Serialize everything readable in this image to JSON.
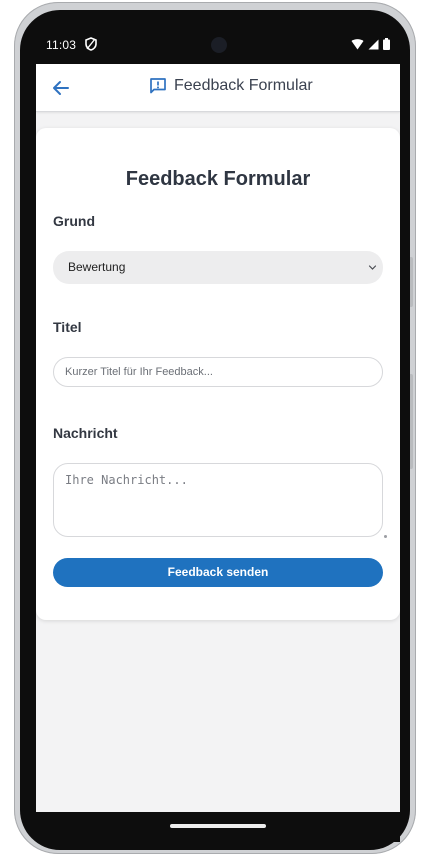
{
  "status_bar": {
    "time": "11:03",
    "icons": [
      "vpn-shield-icon",
      "wifi-icon",
      "cell-signal-icon",
      "battery-icon"
    ]
  },
  "app_bar": {
    "title": "Feedback Formular",
    "back_icon": "arrow-left-icon",
    "title_icon": "feedback-icon"
  },
  "form": {
    "title": "Feedback Formular",
    "reason": {
      "label": "Grund",
      "selected": "Bewertung"
    },
    "subject": {
      "label": "Titel",
      "placeholder": "Kurzer Titel für Ihr Feedback..."
    },
    "message": {
      "label": "Nachricht",
      "placeholder": "Ihre Nachricht..."
    },
    "submit_label": "Feedback senden"
  },
  "colors": {
    "accent": "#1f72bf",
    "app_bar_bg": "#ffffff",
    "screen_bg": "#f3f3f4"
  }
}
